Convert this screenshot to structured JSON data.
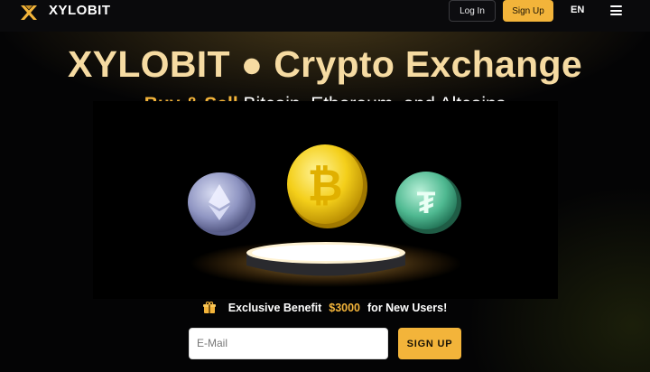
{
  "brand": {
    "name": "XYLOBIT",
    "accent_color": "#f3b43a"
  },
  "nav": {
    "login_label": "Log In",
    "signup_label": "Sign Up",
    "language": "EN"
  },
  "hero": {
    "title": "XYLOBIT ● Crypto Exchange",
    "subtitle_accent": "Buy & Sell",
    "subtitle_rest": "Bitcoin, Ethereum, and Altcoins"
  },
  "benefit": {
    "text": "Exclusive Benefit",
    "amount": "$3000",
    "suffix": "for New Users!"
  },
  "signup": {
    "email_placeholder": "E-Mail",
    "button_label": "SIGN UP"
  },
  "icons": [
    "xylobit-logo-icon",
    "menu-icon",
    "gift-icon",
    "ethereum-coin-icon",
    "bitcoin-coin-icon",
    "tether-coin-icon"
  ]
}
